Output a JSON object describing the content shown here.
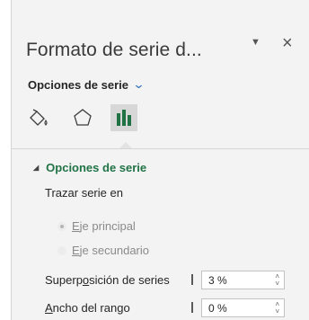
{
  "pane": {
    "title": "Formato de serie d...",
    "close_glyph": "×",
    "dropdown_glyph": "▼"
  },
  "options_menu": {
    "label": "Opciones de serie",
    "chevron": "⌄"
  },
  "tabs": [
    {
      "name": "fill-line-icon",
      "selected": false
    },
    {
      "name": "effects-pentagon-icon",
      "selected": false
    },
    {
      "name": "series-options-bar-chart-icon",
      "selected": true
    }
  ],
  "section": {
    "label": "Opciones de serie",
    "collapse_glyph": "◢"
  },
  "plot_series_on": {
    "label": "Trazar serie en",
    "primary": {
      "label_first": "E",
      "label_rest": "je principal",
      "selected": true
    },
    "secondary": {
      "label_first": "E",
      "label_rest": "je secundario",
      "selected": false
    }
  },
  "overlap": {
    "label_pre": "Superp",
    "label_ul": "o",
    "label_post": "sición de series",
    "value": "3 %"
  },
  "gap_width": {
    "label_first": "A",
    "label_rest": "ncho del rango",
    "value": "0 %"
  },
  "colors": {
    "accent": "#217346",
    "chevron_blue": "#2f6fbd"
  }
}
